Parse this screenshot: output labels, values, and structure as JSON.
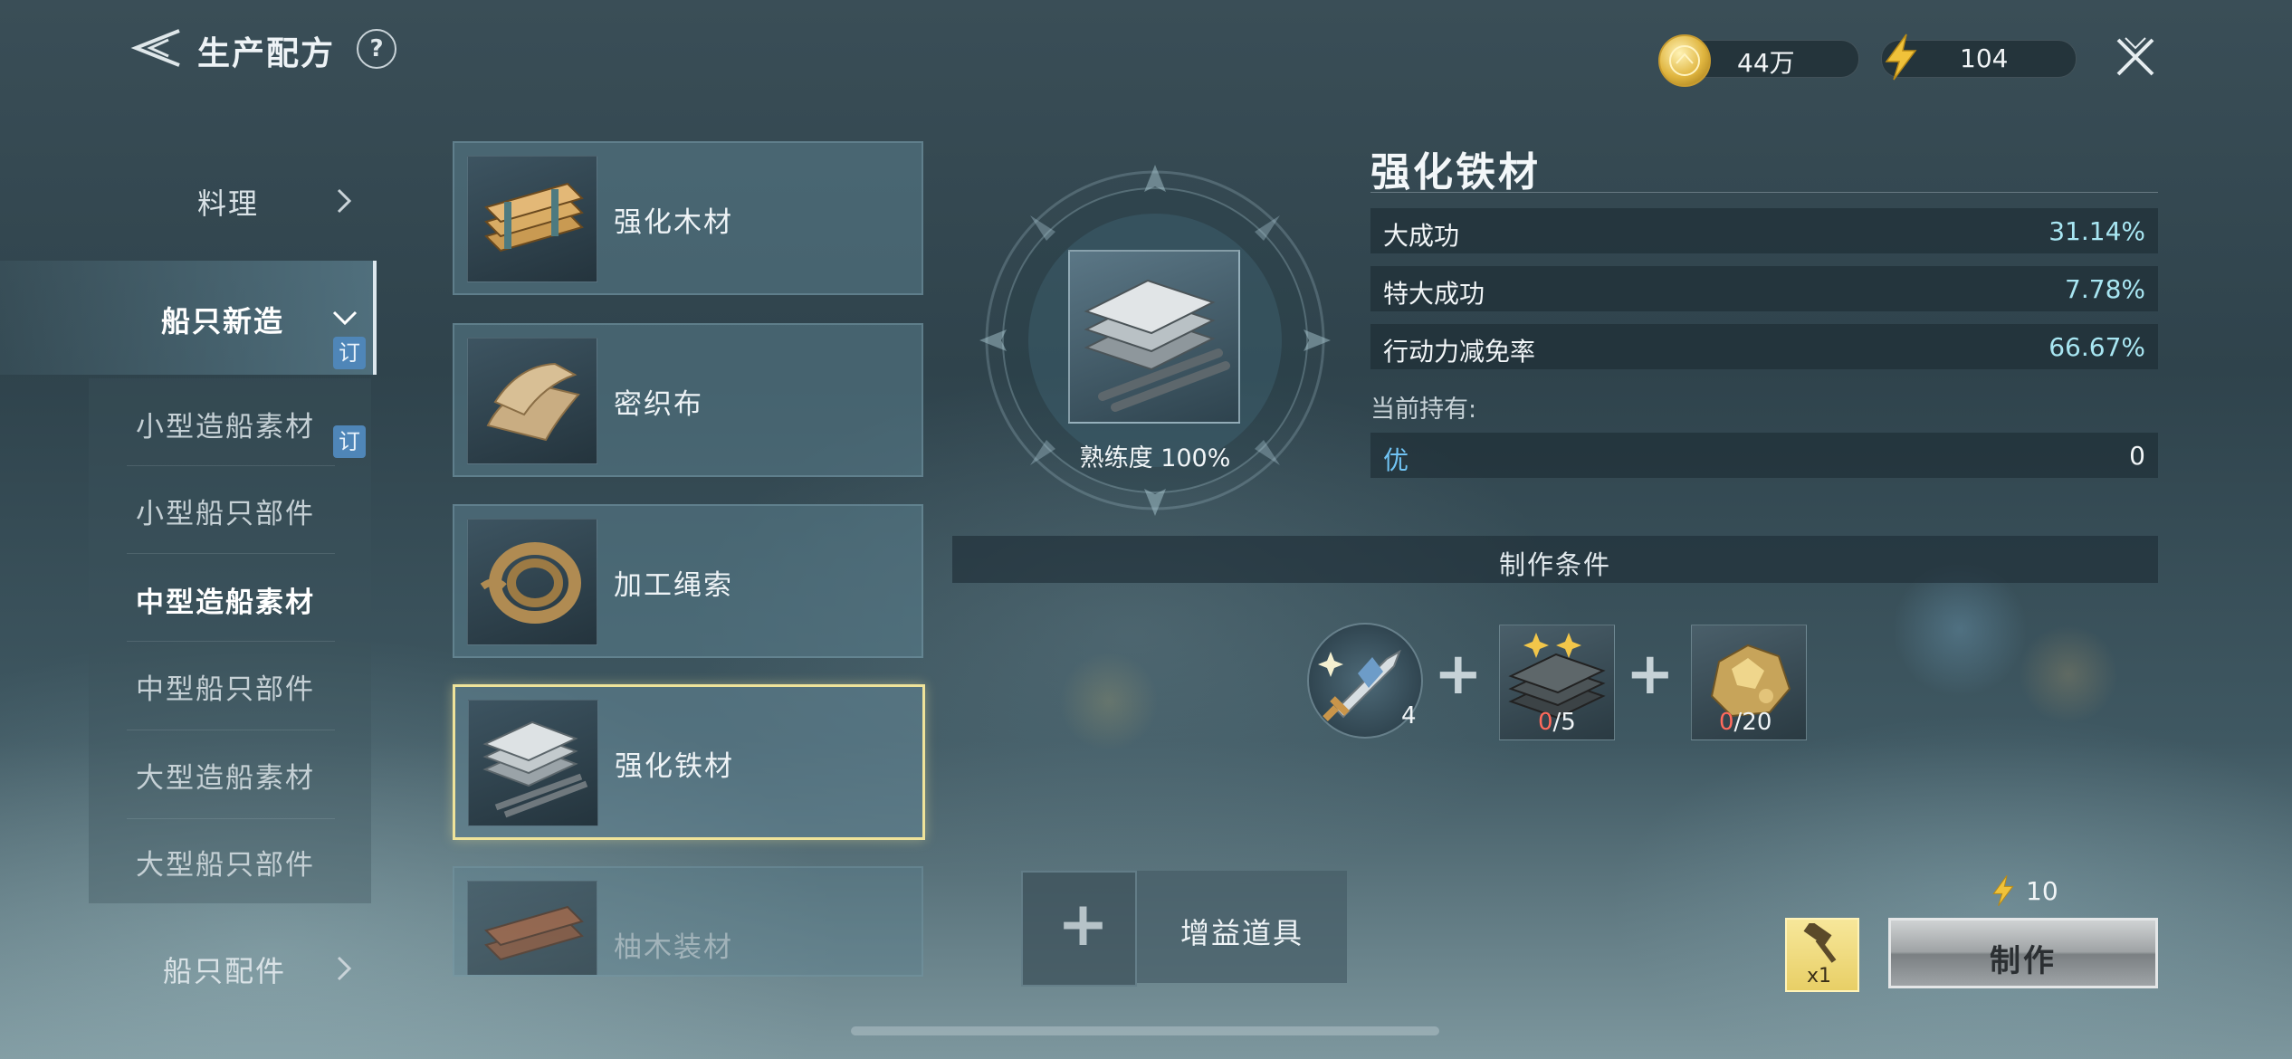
{
  "header": {
    "title": "生产配方",
    "help_label": "?",
    "coin_value": "44万",
    "energy_value": "104"
  },
  "menu": {
    "items": [
      {
        "label": "料理"
      },
      {
        "label": "船只新造"
      },
      {
        "label": "船只配件"
      }
    ],
    "tag_label": "订",
    "sub_items": [
      {
        "label": "小型造船素材"
      },
      {
        "label": "小型船只部件"
      },
      {
        "label": "中型造船素材"
      },
      {
        "label": "中型船只部件"
      },
      {
        "label": "大型造船素材"
      },
      {
        "label": "大型船只部件"
      }
    ]
  },
  "recipes": [
    {
      "label": "强化木材",
      "icon": "wood-planks-icon"
    },
    {
      "label": "密织布",
      "icon": "cloth-icon"
    },
    {
      "label": "加工绳索",
      "icon": "rope-icon"
    },
    {
      "label": "强化铁材",
      "icon": "iron-plates-icon"
    },
    {
      "label": "柚木装材",
      "icon": "teak-icon"
    }
  ],
  "detail": {
    "title": "强化铁材",
    "mastery": "熟练度 100%",
    "stats": [
      {
        "label": "大成功",
        "value": "31.14%"
      },
      {
        "label": "特大成功",
        "value": "7.78%"
      },
      {
        "label": "行动力减免率",
        "value": "66.67%"
      }
    ],
    "holding_label": "当前持有:",
    "holding_quality": "优",
    "holding_count": "0",
    "conditions_label": "制作条件",
    "skill_level": "4",
    "materials": [
      {
        "icon": "iron-ingot-icon",
        "have": "0",
        "need": "/5"
      },
      {
        "icon": "gold-ore-icon",
        "have": "0",
        "need": "/20"
      }
    ],
    "plus_symbol": "+"
  },
  "footer": {
    "add_symbol": "+",
    "buff_label": "增益道具",
    "hammer_count": "x1",
    "energy_cost": "10",
    "make_label": "制作"
  },
  "colors": {
    "accent_value": "#a8e6f2",
    "quality_blue": "#71c4f5",
    "selected_border": "#efe39a",
    "material_missing": "#ff6a5c"
  }
}
